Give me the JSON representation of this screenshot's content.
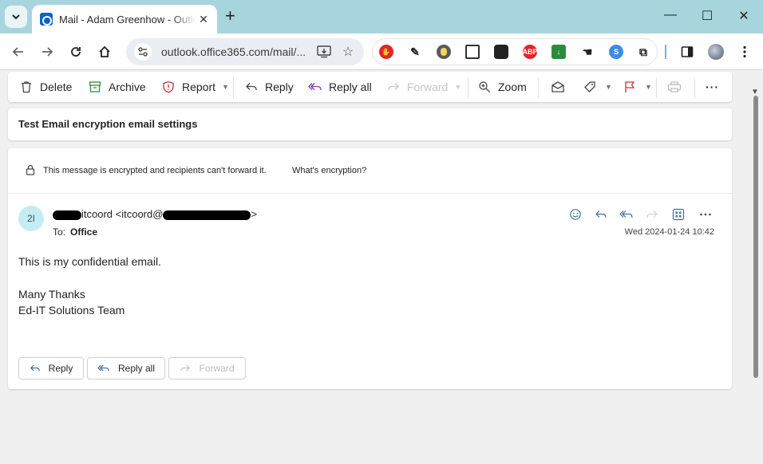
{
  "browser": {
    "tab_title": "Mail - Adam Greenhow - Outlook",
    "url": "outlook.office365.com/mail/...",
    "new_tab": "+",
    "tab_close": "✕",
    "window": {
      "minimize": "—",
      "maximize": "☐",
      "close": "✕"
    },
    "accent_color": "#a8d5dd"
  },
  "commands": {
    "delete": "Delete",
    "archive": "Archive",
    "report": "Report",
    "reply": "Reply",
    "reply_all": "Reply all",
    "forward": "Forward",
    "zoom": "Zoom",
    "more": "···"
  },
  "email": {
    "subject": "Test Email encryption email settings",
    "encryption_notice": "This message is encrypted and recipients can't forward it.",
    "encryption_link": "What's encryption?",
    "avatar_initials": "2I",
    "sender_visible_1": "itcoord <itcoord@",
    "sender_visible_2": ">",
    "to_label": "To:",
    "to_value": "Office",
    "date": "Wed 2024-01-24 10:42",
    "body_line1": "This is my confidential email.",
    "body_line2": "Many Thanks",
    "body_line3": "Ed-IT Solutions Team"
  },
  "footer": {
    "reply": "Reply",
    "reply_all": "Reply all",
    "forward": "Forward"
  }
}
